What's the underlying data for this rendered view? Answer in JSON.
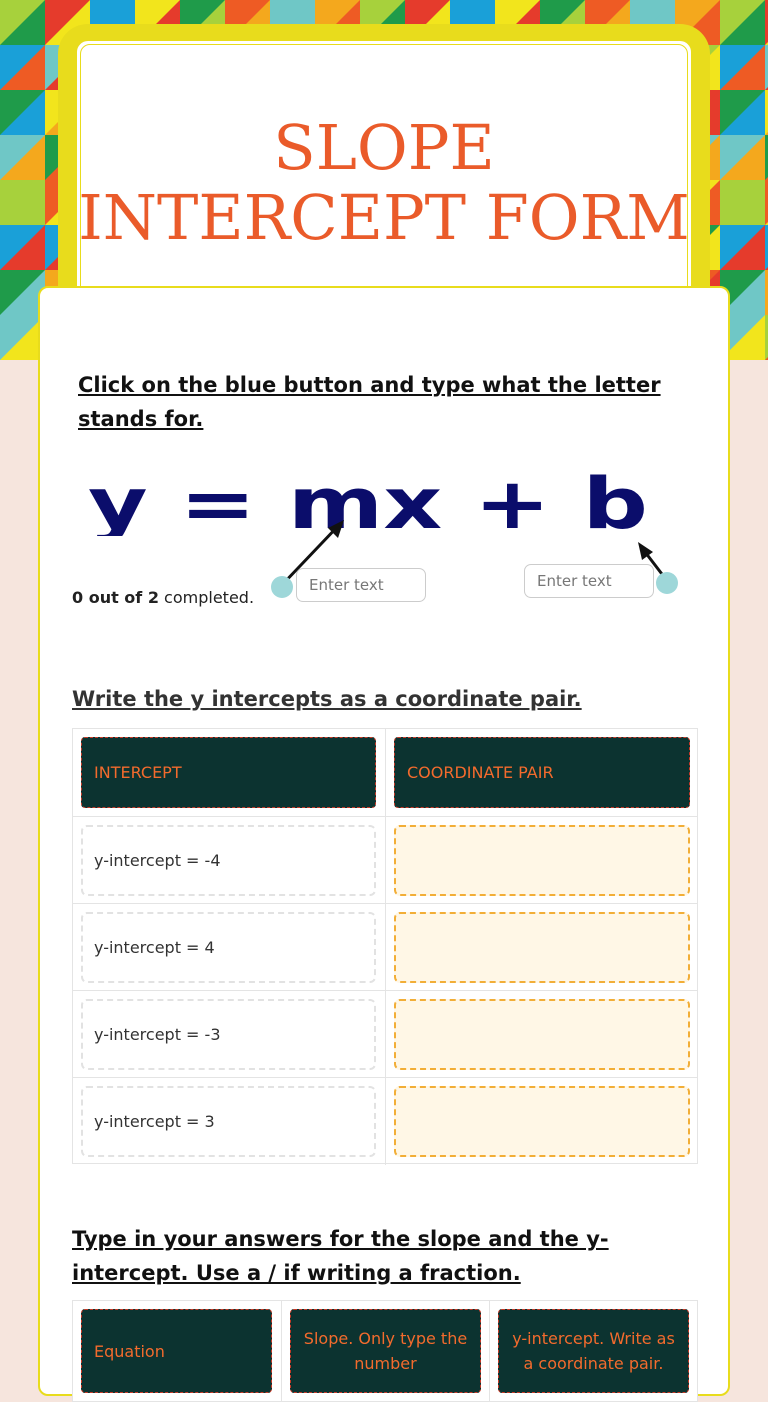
{
  "title": "SLOPE INTERCEPT FORM",
  "section1": {
    "instruction": "Click on the blue button and type what the letter stands for.",
    "equation_text": "y = mx + b",
    "input_placeholder_1": "Enter text",
    "input_placeholder_2": "Enter text",
    "progress_bold": "0 out of 2",
    "progress_rest": " completed."
  },
  "section2": {
    "instruction": "Write the y intercepts as a coordinate pair.",
    "headers": [
      "INTERCEPT",
      "COORDINATE PAIR"
    ],
    "items": [
      "y-intercept = -4",
      "y-intercept = 4",
      "y-intercept = -3",
      "y-intercept = 3"
    ]
  },
  "section3": {
    "instruction": "Type in your answers for the slope and the y-intercept. Use a / if writing  a fraction.",
    "headers": [
      "Equation",
      "Slope.  Only type the number",
      "y-intercept.  Write as a coordinate pair."
    ]
  },
  "colors": {
    "title": "#ea5b2a",
    "header_bg": "#0c3330",
    "accent": "#f36b2d",
    "frame": "#e8dc1c"
  }
}
